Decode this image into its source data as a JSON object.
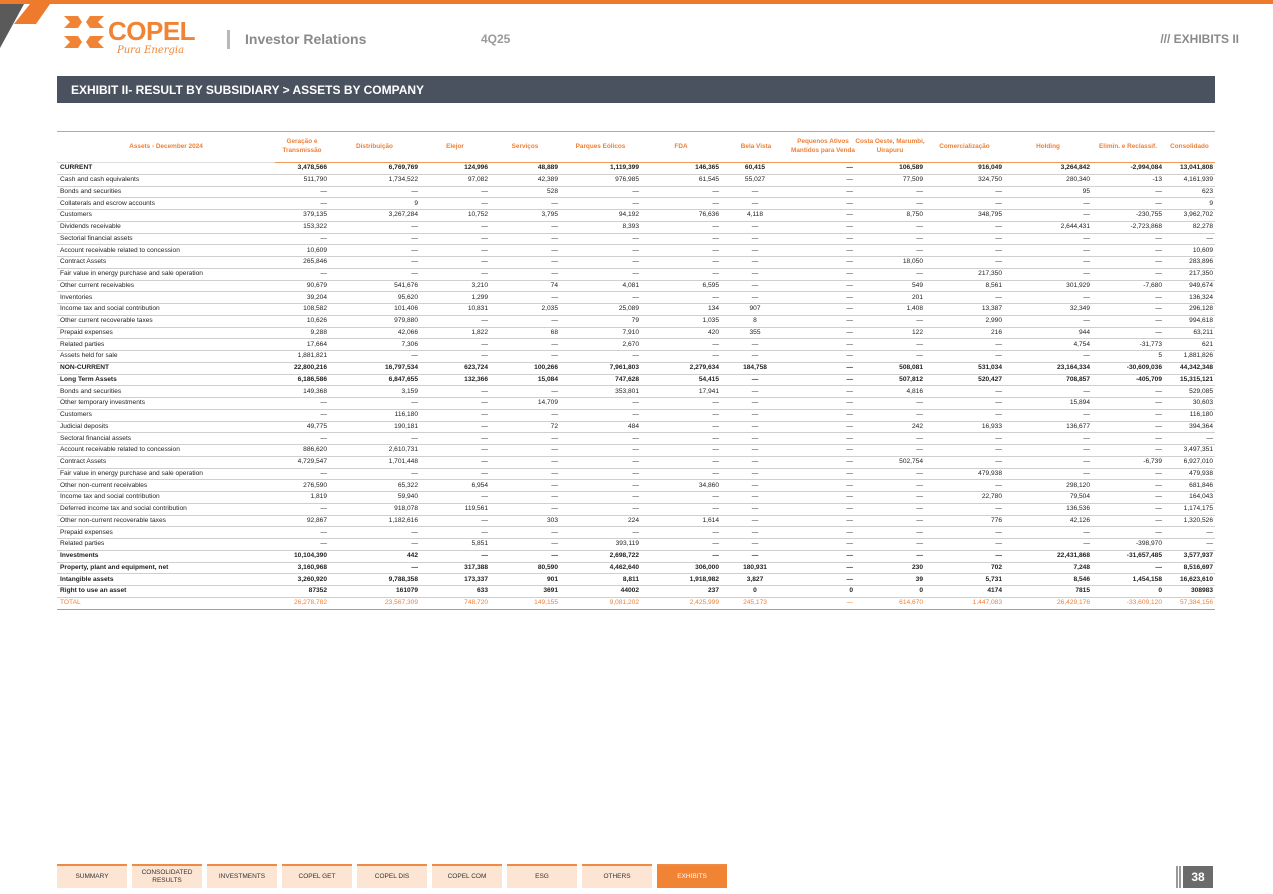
{
  "header": {
    "logo_text": "COPEL",
    "logo_tagline": "Pura Energia",
    "section": "Investor Relations",
    "quarter": "4Q25",
    "exhibit": "/// EXHIBITS II"
  },
  "banner": {
    "title": "EXHIBIT II- RESULT BY SUBSIDIARY > ASSETS BY COMPANY"
  },
  "colors": {
    "accent": "#EE7A2E",
    "banner": "#4A5260"
  },
  "table": {
    "columns": [
      "Assets - December 2024",
      "Geração e Transmissão",
      "Distribuição",
      "Elejor",
      "Serviços",
      "Parques Eólicos",
      "FDA",
      "Bela Vista",
      "Pequenos Ativos Mantidos para Venda",
      "Costa Oeste, Marumbi, Uirapuru",
      "Comercialização",
      "Holding",
      "Elimin. e Reclassif.",
      "Consolidado"
    ],
    "rows": [
      {
        "style": "bold",
        "cells": [
          "CURRENT",
          "3,478,566",
          "6,769,769",
          "124,996",
          "48,889",
          "1,119,399",
          "146,365",
          "60,415",
          "—",
          "106,589",
          "916,049",
          "3,264,842",
          "-2,994,084",
          "13,041,808"
        ]
      },
      {
        "cells": [
          "Cash and cash equivalents",
          "511,790",
          "1,734,522",
          "97,082",
          "42,389",
          "976,985",
          "61,545",
          "55,027",
          "—",
          "77,509",
          "324,750",
          "280,340",
          "-13",
          "4,161,939"
        ]
      },
      {
        "cells": [
          "Bonds and securities",
          "—",
          "—",
          "—",
          "528",
          "—",
          "—",
          "—",
          "—",
          "—",
          "—",
          "95",
          "—",
          "623"
        ]
      },
      {
        "cells": [
          "Collaterals and escrow accounts",
          "—",
          "9",
          "—",
          "—",
          "—",
          "—",
          "—",
          "—",
          "—",
          "—",
          "—",
          "—",
          "9"
        ]
      },
      {
        "cells": [
          "Customers",
          "379,135",
          "3,267,284",
          "10,752",
          "3,795",
          "94,192",
          "76,636",
          "4,118",
          "—",
          "8,750",
          "348,795",
          "—",
          "-230,755",
          "3,962,702"
        ]
      },
      {
        "cells": [
          "Dividends receivable",
          "153,322",
          "—",
          "—",
          "—",
          "8,393",
          "—",
          "—",
          "—",
          "—",
          "—",
          "2,644,431",
          "-2,723,868",
          "82,278"
        ]
      },
      {
        "cells": [
          "Sectorial financial assets",
          "—",
          "—",
          "—",
          "—",
          "—",
          "—",
          "—",
          "—",
          "—",
          "—",
          "—",
          "—",
          "—"
        ]
      },
      {
        "cells": [
          "Account receivable related to concession",
          "10,609",
          "—",
          "—",
          "—",
          "—",
          "—",
          "—",
          "—",
          "—",
          "—",
          "—",
          "—",
          "10,609"
        ]
      },
      {
        "cells": [
          "Contract Assets",
          "265,846",
          "—",
          "—",
          "—",
          "—",
          "—",
          "—",
          "—",
          "18,050",
          "—",
          "—",
          "—",
          "283,896"
        ]
      },
      {
        "cells": [
          "Fair value in energy purchase and sale operation",
          "—",
          "—",
          "—",
          "—",
          "—",
          "—",
          "—",
          "—",
          "—",
          "217,350",
          "—",
          "—",
          "217,350"
        ]
      },
      {
        "cells": [
          "Other current receivables",
          "90,679",
          "541,676",
          "3,210",
          "74",
          "4,081",
          "6,595",
          "—",
          "—",
          "549",
          "8,561",
          "301,929",
          "-7,680",
          "949,674"
        ]
      },
      {
        "cells": [
          "Inventories",
          "39,204",
          "95,620",
          "1,299",
          "—",
          "—",
          "—",
          "—",
          "—",
          "201",
          "—",
          "—",
          "—",
          "136,324"
        ]
      },
      {
        "cells": [
          "Income tax and social contribution",
          "108,582",
          "101,406",
          "10,831",
          "2,035",
          "25,089",
          "134",
          "907",
          "—",
          "1,408",
          "13,387",
          "32,349",
          "—",
          "296,128"
        ]
      },
      {
        "cells": [
          "Other current recoverable taxes",
          "10,626",
          "979,880",
          "—",
          "—",
          "79",
          "1,035",
          "8",
          "—",
          "—",
          "2,990",
          "—",
          "—",
          "994,618"
        ]
      },
      {
        "cells": [
          "Prepaid expenses",
          "9,288",
          "42,066",
          "1,822",
          "68",
          "7,910",
          "420",
          "355",
          "—",
          "122",
          "216",
          "944",
          "—",
          "63,211"
        ]
      },
      {
        "cells": [
          "Related parties",
          "17,664",
          "7,306",
          "—",
          "—",
          "2,670",
          "—",
          "—",
          "—",
          "—",
          "—",
          "4,754",
          "-31,773",
          "621"
        ]
      },
      {
        "cells": [
          "Assets held for sale",
          "1,881,821",
          "—",
          "—",
          "—",
          "—",
          "—",
          "—",
          "—",
          "—",
          "—",
          "—",
          "5",
          "1,881,826"
        ]
      },
      {
        "style": "bold",
        "cells": [
          "NON-CURRENT",
          "22,800,216",
          "16,797,534",
          "623,724",
          "100,266",
          "7,961,803",
          "2,279,634",
          "184,758",
          "—",
          "508,081",
          "531,034",
          "23,164,334",
          "-30,609,036",
          "44,342,348"
        ]
      },
      {
        "style": "bold",
        "cells": [
          "Long Term Assets",
          "6,186,586",
          "6,847,655",
          "132,366",
          "15,084",
          "747,628",
          "54,415",
          "—",
          "—",
          "507,812",
          "520,427",
          "708,857",
          "-405,709",
          "15,315,121"
        ]
      },
      {
        "cells": [
          "Bonds and securities",
          "149,368",
          "3,159",
          "—",
          "—",
          "353,801",
          "17,941",
          "—",
          "—",
          "4,816",
          "—",
          "—",
          "—",
          "529,085"
        ]
      },
      {
        "cells": [
          "Other temporary investments",
          "—",
          "—",
          "—",
          "14,709",
          "—",
          "—",
          "—",
          "—",
          "—",
          "—",
          "15,894",
          "—",
          "30,603"
        ]
      },
      {
        "cells": [
          "Customers",
          "—",
          "116,180",
          "—",
          "—",
          "—",
          "—",
          "—",
          "—",
          "—",
          "—",
          "—",
          "—",
          "116,180"
        ]
      },
      {
        "cells": [
          "Judicial deposits",
          "49,775",
          "190,181",
          "—",
          "72",
          "484",
          "—",
          "—",
          "—",
          "242",
          "16,933",
          "136,677",
          "—",
          "394,364"
        ]
      },
      {
        "cells": [
          "Sectoral financial assets",
          "—",
          "—",
          "—",
          "—",
          "—",
          "—",
          "—",
          "—",
          "—",
          "—",
          "—",
          "—",
          "—"
        ]
      },
      {
        "cells": [
          "Account receivable related to concession",
          "886,620",
          "2,610,731",
          "—",
          "—",
          "—",
          "—",
          "—",
          "—",
          "—",
          "—",
          "—",
          "—",
          "3,497,351"
        ]
      },
      {
        "cells": [
          "Contract Assets",
          "4,729,547",
          "1,701,448",
          "—",
          "—",
          "—",
          "—",
          "—",
          "—",
          "502,754",
          "—",
          "—",
          "-6,739",
          "6,927,010"
        ]
      },
      {
        "cells": [
          "Fair value in energy purchase and sale operation",
          "—",
          "—",
          "—",
          "—",
          "—",
          "—",
          "—",
          "—",
          "—",
          "479,938",
          "—",
          "—",
          "479,938"
        ]
      },
      {
        "cells": [
          "Other non-current receivables",
          "276,590",
          "65,322",
          "6,954",
          "—",
          "—",
          "34,860",
          "—",
          "—",
          "—",
          "—",
          "298,120",
          "—",
          "681,846"
        ]
      },
      {
        "cells": [
          "Income tax and social contribution",
          "1,819",
          "59,940",
          "—",
          "—",
          "—",
          "—",
          "—",
          "—",
          "—",
          "22,780",
          "79,504",
          "—",
          "164,043"
        ]
      },
      {
        "cells": [
          "Deferred income tax and social contribution",
          "—",
          "918,078",
          "119,561",
          "—",
          "—",
          "—",
          "—",
          "—",
          "—",
          "—",
          "136,536",
          "—",
          "1,174,175"
        ]
      },
      {
        "cells": [
          "Other non-current recoverable taxes",
          "92,867",
          "1,182,616",
          "—",
          "303",
          "224",
          "1,614",
          "—",
          "—",
          "—",
          "776",
          "42,126",
          "—",
          "1,320,526"
        ]
      },
      {
        "cells": [
          "Prepaid expenses",
          "—",
          "—",
          "—",
          "—",
          "—",
          "—",
          "—",
          "—",
          "—",
          "—",
          "—",
          "—",
          "—"
        ]
      },
      {
        "cells": [
          "Related parties",
          "—",
          "—",
          "5,851",
          "—",
          "393,119",
          "—",
          "—",
          "—",
          "—",
          "—",
          "—",
          "-398,970",
          "—"
        ]
      },
      {
        "style": "bold",
        "cells": [
          "Investments",
          "10,104,390",
          "442",
          "—",
          "—",
          "2,698,722",
          "—",
          "—",
          "—",
          "—",
          "—",
          "22,431,868",
          "-31,657,485",
          "3,577,937"
        ]
      },
      {
        "style": "bold",
        "cells": [
          "Property, plant and equipment, net",
          "3,160,968",
          "—",
          "317,388",
          "80,590",
          "4,462,640",
          "306,000",
          "180,931",
          "—",
          "230",
          "702",
          "7,248",
          "—",
          "8,516,697"
        ]
      },
      {
        "style": "bold",
        "cells": [
          "Intangible assets",
          "3,260,920",
          "9,788,358",
          "173,337",
          "901",
          "8,811",
          "1,918,982",
          "3,827",
          "—",
          "39",
          "5,731",
          "8,546",
          "1,454,158",
          "16,623,610"
        ]
      },
      {
        "style": "bold",
        "cells": [
          "Right to use an asset",
          "87352",
          "161079",
          "633",
          "3691",
          "44002",
          "237",
          "0",
          "0",
          "0",
          "4174",
          "7815",
          "0",
          "308983"
        ]
      },
      {
        "style": "total",
        "cells": [
          "TOTAL",
          "26,278,782",
          "23,567,309",
          "748,720",
          "149,155",
          "9,081,202",
          "2,425,999",
          "245,173",
          "—",
          "614,670",
          "1,447,083",
          "26,429,176",
          "-33,609,120",
          "57,384,156"
        ]
      }
    ]
  },
  "nav": {
    "tabs": [
      "SUMMARY",
      "CONSOLIDATED RESULTS",
      "INVESTMENTS",
      "COPEL GET",
      "COPEL DIS",
      "COPEL COM",
      "ESG",
      "OTHERS",
      "EXHIBITS"
    ],
    "active": "EXHIBITS"
  },
  "page_number": "38"
}
